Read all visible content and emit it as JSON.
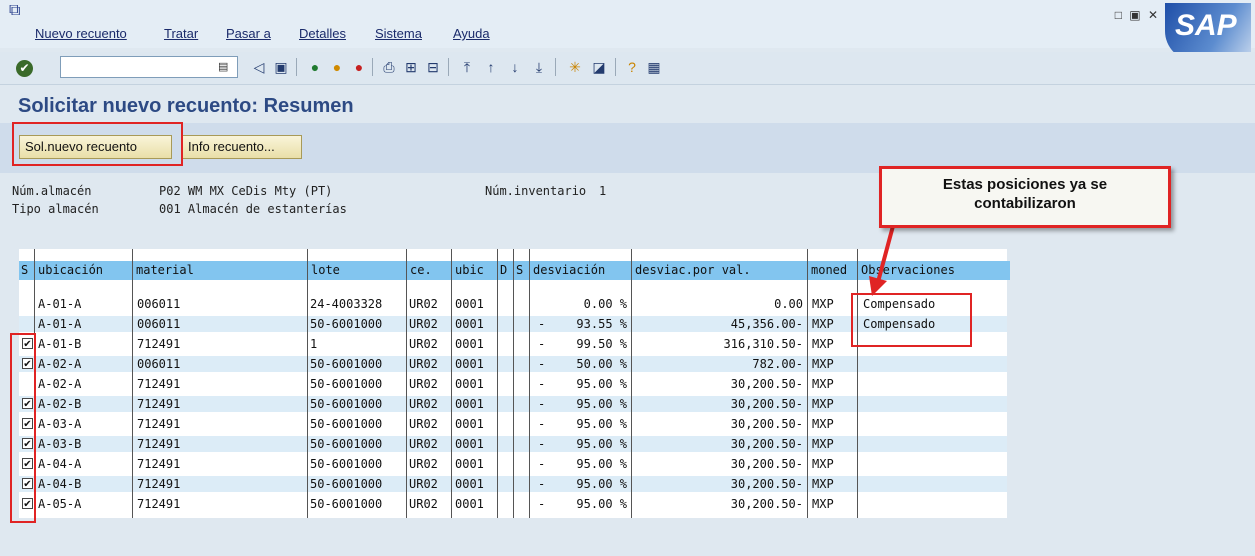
{
  "menu": [
    "Nuevo recuento",
    "Tratar",
    "Pasar a",
    "Detalles",
    "Sistema",
    "Ayuda"
  ],
  "window_controls": "□ ▣ ✕",
  "logo": "SAP",
  "toolbar": {
    "command_value": ""
  },
  "page_title": "Solicitar nuevo recuento: Resumen",
  "buttons": {
    "new_count": "Sol.nuevo recuento",
    "count_info": "Info recuento..."
  },
  "header": {
    "warehouse_label": "Núm.almacén",
    "warehouse_value": "P02 WM MX CeDis Mty (PT)",
    "inventory_label": "Núm.inventario",
    "inventory_value": "1",
    "storage_type_label": "Tipo almacén",
    "storage_type_value": "001 Almacén de estanterías"
  },
  "callout": {
    "line1": "Estas posiciones ya se",
    "line2": "contabilizaron"
  },
  "table": {
    "columns": [
      "S",
      "ubicación",
      "material",
      "lote",
      "ce.",
      "ubic",
      "D",
      "S",
      "desviación",
      "desviac.por val.",
      "moned",
      "Observaciones"
    ],
    "rows": [
      {
        "checked": false,
        "ubic": "A-01-A",
        "material": "006011",
        "lote": "24-4003328",
        "ce": "UR02",
        "ubic2": "0001",
        "sign": "",
        "desv": "0.00 %",
        "desv_val": "0.00",
        "moned": "MXP",
        "obs": "Compensado"
      },
      {
        "checked": false,
        "ubic": "A-01-A",
        "material": "006011",
        "lote": "50-6001000",
        "ce": "UR02",
        "ubic2": "0001",
        "sign": "-",
        "desv": "93.55 %",
        "desv_val": "45,356.00-",
        "moned": "MXP",
        "obs": "Compensado"
      },
      {
        "checked": true,
        "ubic": "A-01-B",
        "material": "712491",
        "lote": "1",
        "ce": "UR02",
        "ubic2": "0001",
        "sign": "-",
        "desv": "99.50 %",
        "desv_val": "316,310.50-",
        "moned": "MXP",
        "obs": ""
      },
      {
        "checked": true,
        "ubic": "A-02-A",
        "material": "006011",
        "lote": "50-6001000",
        "ce": "UR02",
        "ubic2": "0001",
        "sign": "-",
        "desv": "50.00 %",
        "desv_val": "782.00-",
        "moned": "MXP",
        "obs": ""
      },
      {
        "checked": false,
        "ubic": "A-02-A",
        "material": "712491",
        "lote": "50-6001000",
        "ce": "UR02",
        "ubic2": "0001",
        "sign": "-",
        "desv": "95.00 %",
        "desv_val": "30,200.50-",
        "moned": "MXP",
        "obs": ""
      },
      {
        "checked": true,
        "ubic": "A-02-B",
        "material": "712491",
        "lote": "50-6001000",
        "ce": "UR02",
        "ubic2": "0001",
        "sign": "-",
        "desv": "95.00 %",
        "desv_val": "30,200.50-",
        "moned": "MXP",
        "obs": ""
      },
      {
        "checked": true,
        "ubic": "A-03-A",
        "material": "712491",
        "lote": "50-6001000",
        "ce": "UR02",
        "ubic2": "0001",
        "sign": "-",
        "desv": "95.00 %",
        "desv_val": "30,200.50-",
        "moned": "MXP",
        "obs": ""
      },
      {
        "checked": true,
        "ubic": "A-03-B",
        "material": "712491",
        "lote": "50-6001000",
        "ce": "UR02",
        "ubic2": "0001",
        "sign": "-",
        "desv": "95.00 %",
        "desv_val": "30,200.50-",
        "moned": "MXP",
        "obs": ""
      },
      {
        "checked": true,
        "ubic": "A-04-A",
        "material": "712491",
        "lote": "50-6001000",
        "ce": "UR02",
        "ubic2": "0001",
        "sign": "-",
        "desv": "95.00 %",
        "desv_val": "30,200.50-",
        "moned": "MXP",
        "obs": ""
      },
      {
        "checked": true,
        "ubic": "A-04-B",
        "material": "712491",
        "lote": "50-6001000",
        "ce": "UR02",
        "ubic2": "0001",
        "sign": "-",
        "desv": "95.00 %",
        "desv_val": "30,200.50-",
        "moned": "MXP",
        "obs": ""
      },
      {
        "checked": true,
        "ubic": "A-05-A",
        "material": "712491",
        "lote": "50-6001000",
        "ce": "UR02",
        "ubic2": "0001",
        "sign": "-",
        "desv": "95.00 %",
        "desv_val": "30,200.50-",
        "moned": "MXP",
        "obs": ""
      }
    ]
  },
  "colors": {
    "header_blue": "#82c5ef",
    "alt_row": "#dcecf7",
    "highlight_red": "#e02424",
    "title_blue": "#2d4a84"
  }
}
